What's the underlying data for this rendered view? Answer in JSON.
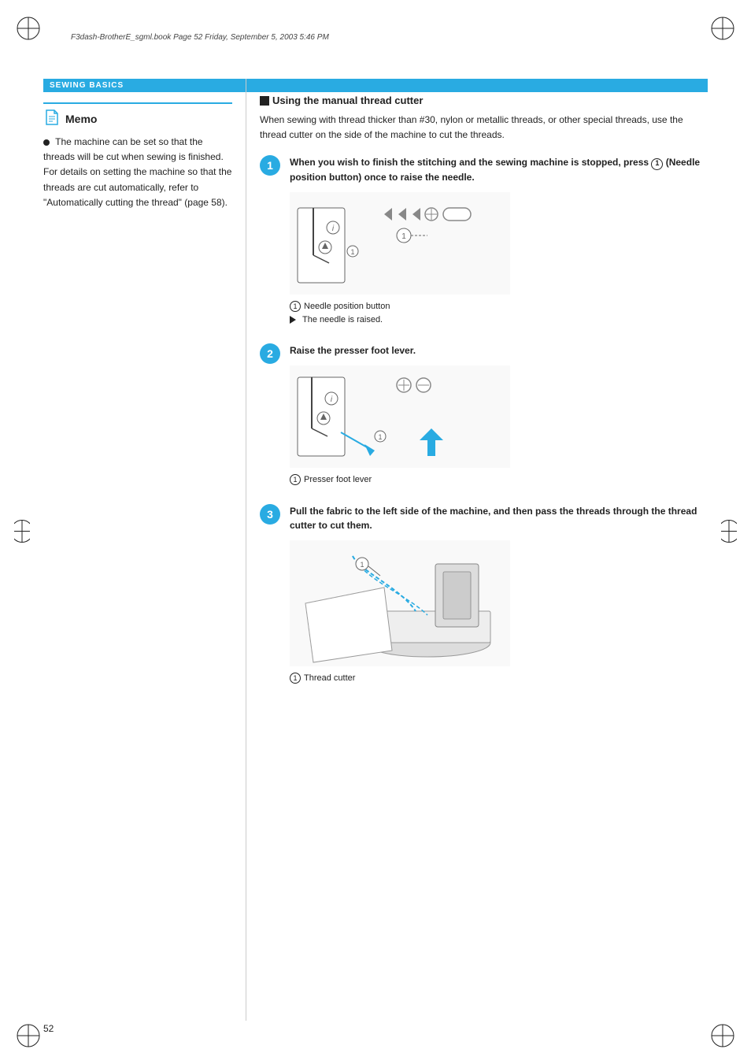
{
  "page": {
    "file_info": "F3dash-BrotherE_sgml.book  Page 52  Friday, September 5, 2003  5:46 PM",
    "section_header": "SEWING BASICS",
    "page_number": "52"
  },
  "memo": {
    "title": "Memo",
    "bullet": "The machine can be set so that the threads will be cut when sewing is finished. For details on setting the machine so that the threads are cut automatically, refer to \"Automatically cutting the thread\" (page 58)."
  },
  "right": {
    "section_title": "Using the manual thread cutter",
    "section_desc": "When sewing with thread thicker than #30, nylon or metallic threads, or other special threads, use the thread cutter on the side of the machine to cut the threads.",
    "steps": [
      {
        "num": "1",
        "title": "When you wish to finish the stitching and the sewing machine is stopped, press ⓘ (Needle position button) once to raise the needle.",
        "captions": [
          {
            "symbol": "circle",
            "text": "Needle position button"
          },
          {
            "symbol": "arrow",
            "text": "The needle is raised."
          }
        ]
      },
      {
        "num": "2",
        "title": "Raise the presser foot lever.",
        "captions": [
          {
            "symbol": "circle",
            "text": "Presser foot lever"
          }
        ]
      },
      {
        "num": "3",
        "title": "Pull the fabric to the left side of the machine, and then pass the threads through the thread cutter to cut them.",
        "captions": [
          {
            "symbol": "circle",
            "text": "Thread cutter"
          }
        ]
      }
    ]
  }
}
